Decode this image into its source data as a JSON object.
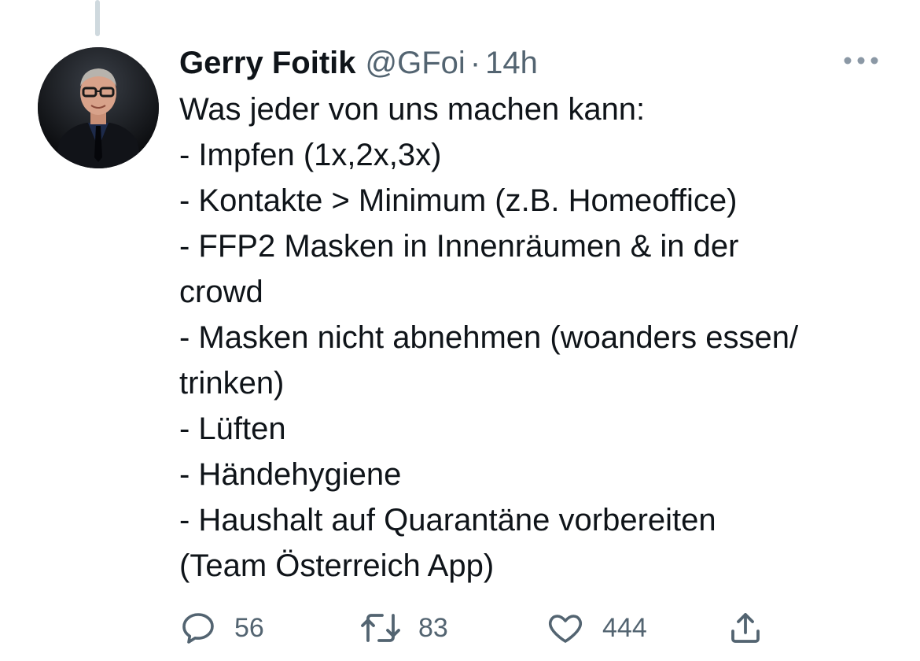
{
  "tweet": {
    "display_name": "Gerry Foitik",
    "handle": "@GFoi",
    "separator": "·",
    "time": "14h",
    "lines": [
      "Was jeder von uns machen kann:",
      "- Impfen (1x,2x,3x)",
      "- Kontakte > Minimum (z.B. Homeoffice)",
      "- FFP2 Masken in Innenräumen & in der",
      "crowd",
      "- Masken nicht abnehmen (woanders essen/",
      "trinken)",
      "- Lüften",
      "- Händehygiene",
      "- Haushalt auf Quarantäne vorbereiten",
      "(Team Österreich App)"
    ]
  },
  "actions": {
    "reply_count": "56",
    "retweet_count": "83",
    "like_count": "444"
  },
  "icons": {
    "more": "more-dots-icon",
    "reply": "reply-icon",
    "retweet": "retweet-icon",
    "like": "heart-icon",
    "share": "share-icon"
  },
  "colors": {
    "text_primary": "#0f1419",
    "text_secondary": "#536471",
    "thread_line": "#cfd9de"
  }
}
